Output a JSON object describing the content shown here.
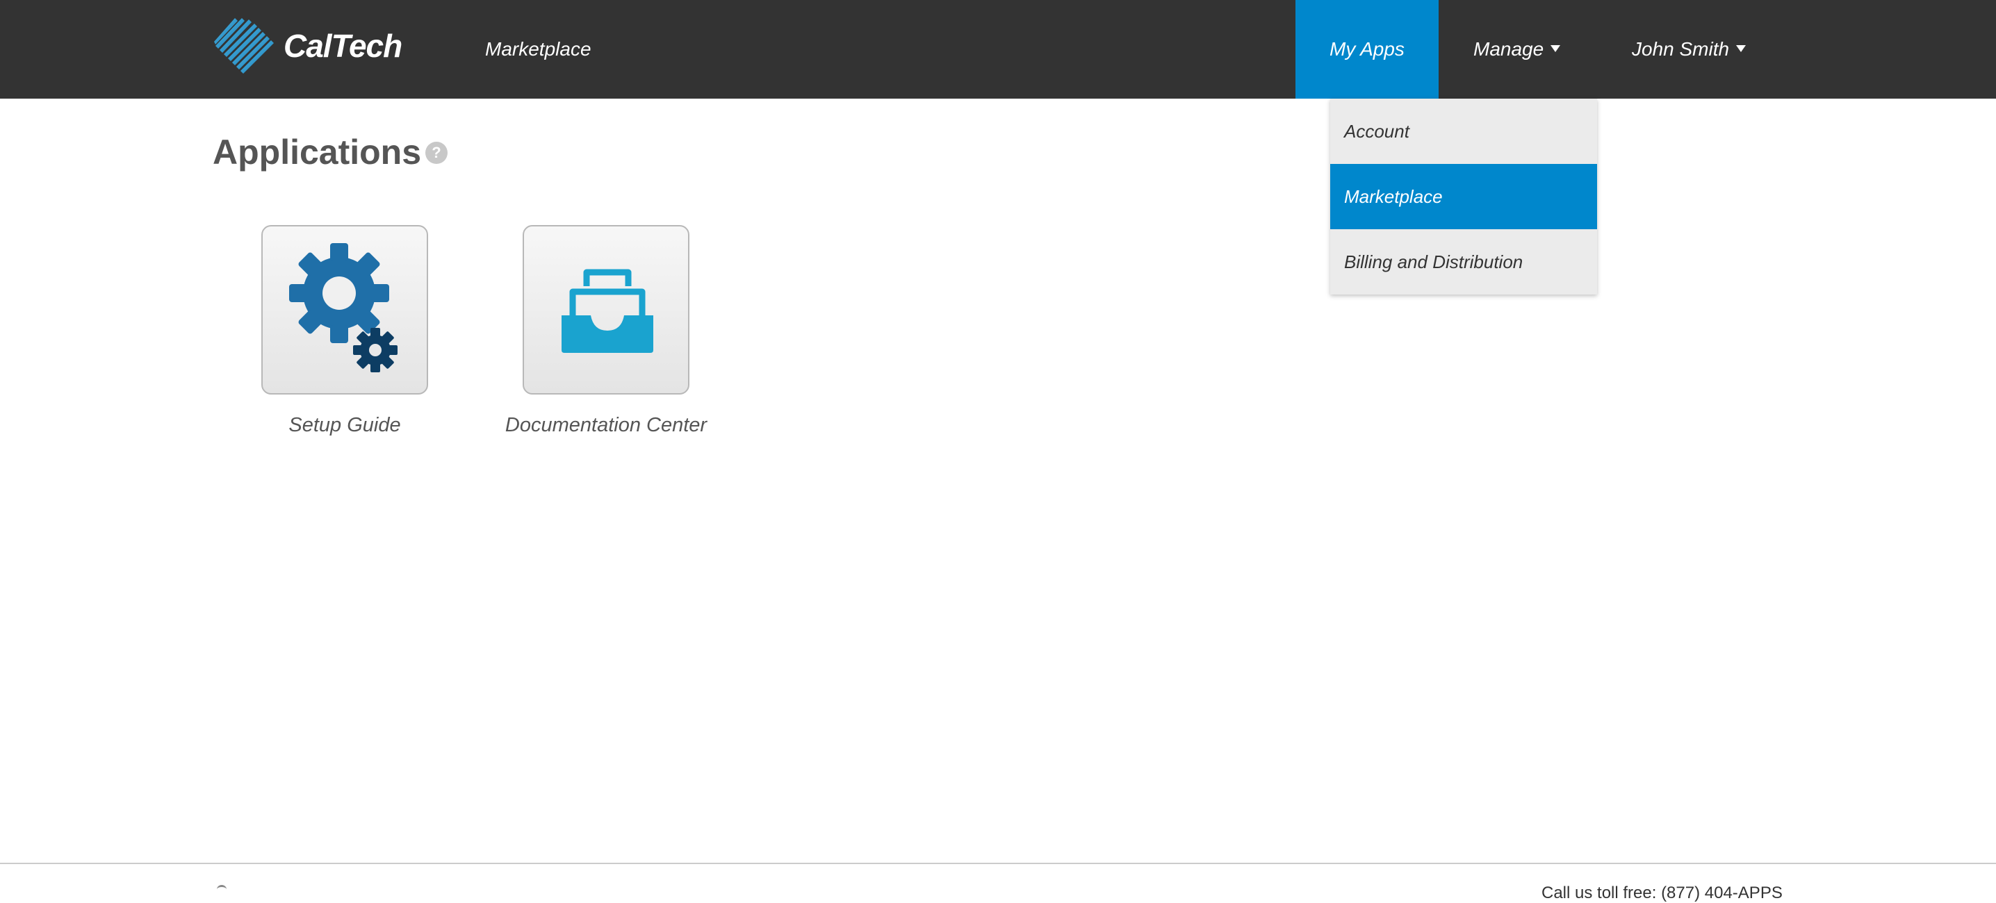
{
  "brand": {
    "name": "CalTech"
  },
  "nav": {
    "marketplace": "Marketplace",
    "my_apps": "My Apps",
    "manage": "Manage",
    "user": "John Smith"
  },
  "dropdown": {
    "items": [
      {
        "label": "Account"
      },
      {
        "label": "Marketplace",
        "active": true
      },
      {
        "label": "Billing and Distribution"
      }
    ]
  },
  "main": {
    "title": "Applications",
    "help": "?",
    "apps": [
      {
        "label": "Setup Guide",
        "icon": "gears-icon"
      },
      {
        "label": "Documentation Center",
        "icon": "inbox-tray-icon"
      }
    ]
  },
  "footer": {
    "contact": "Call us toll free: (877) 404-APPS"
  },
  "colors": {
    "topbar": "#333333",
    "accent": "#0087cc",
    "dropdown_bg": "#ebebeb",
    "gear_primary": "#1f6fa8",
    "gear_secondary": "#0d3d63",
    "tray": "#1aa3cf"
  }
}
